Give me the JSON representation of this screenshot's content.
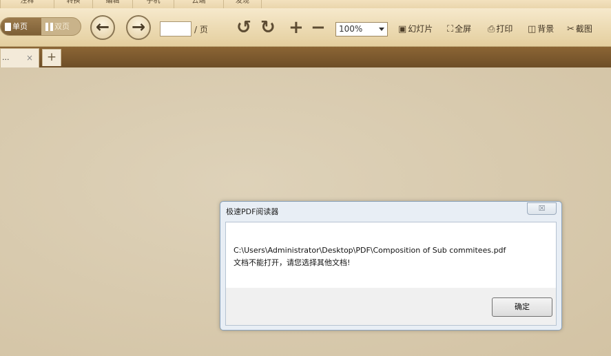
{
  "ribbon": {
    "tabs": [
      "注释",
      "转换",
      "编辑",
      "手机",
      "云端",
      "发现"
    ]
  },
  "toolbar": {
    "single_page_label": "单页",
    "double_page_label": "双页",
    "prev_glyph": "←",
    "next_glyph": "→",
    "page_value": "",
    "page_suffix": "/ 页",
    "rotate_left_glyph": "↺",
    "rotate_right_glyph": "↻",
    "zoom_in_glyph": "+",
    "zoom_out_glyph": "−",
    "zoom_value": "100%",
    "slideshow_label": "幻灯片",
    "fullscreen_label": "全屏",
    "print_label": "打印",
    "background_label": "背景",
    "screenshot_label": "截图"
  },
  "tabs": {
    "doc_tab_label": "...",
    "close_glyph": "×",
    "new_tab_glyph": "+"
  },
  "dialog": {
    "title": "极速PDF阅读器",
    "close_glyph": "☒",
    "message_path": "C:\\Users\\Administrator\\Desktop\\PDF\\Composition of Sub commitees.pdf",
    "message_error": "文档不能打开，请您选择其他文档!",
    "ok_label": "确定"
  },
  "colors": {
    "toolbar_bg": "#ecdab2",
    "tabstrip_bg": "#7d5a2e",
    "workspace_bg": "#d9cbb0",
    "dialog_frame": "#e8eef5"
  }
}
